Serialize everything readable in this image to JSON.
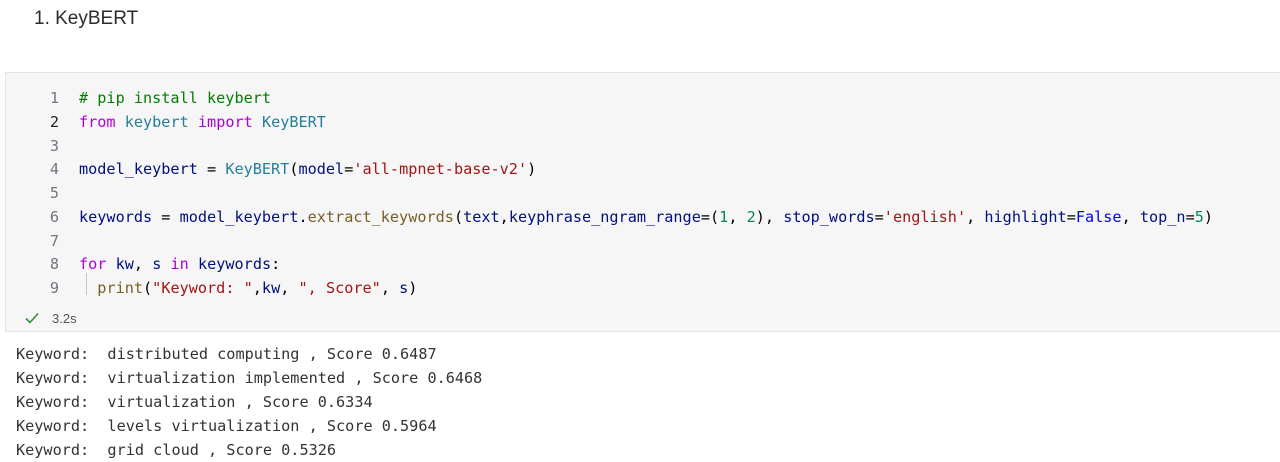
{
  "heading": "1. KeyBERT",
  "code": {
    "lines": [
      {
        "num": "1",
        "tokens": [
          {
            "t": "comment",
            "v": "# pip install keybert"
          }
        ]
      },
      {
        "num": "2",
        "tokens": [
          {
            "t": "kw",
            "v": "from"
          },
          {
            "t": "plain",
            "v": " "
          },
          {
            "t": "module",
            "v": "keybert"
          },
          {
            "t": "plain",
            "v": " "
          },
          {
            "t": "kw",
            "v": "import"
          },
          {
            "t": "plain",
            "v": " "
          },
          {
            "t": "module",
            "v": "KeyBERT"
          }
        ]
      },
      {
        "num": "3",
        "tokens": []
      },
      {
        "num": "4",
        "tokens": [
          {
            "t": "var",
            "v": "model_keybert"
          },
          {
            "t": "plain",
            "v": " = "
          },
          {
            "t": "module",
            "v": "KeyBERT"
          },
          {
            "t": "plain",
            "v": "("
          },
          {
            "t": "var",
            "v": "model"
          },
          {
            "t": "plain",
            "v": "="
          },
          {
            "t": "str",
            "v": "'all-mpnet-base-v2'"
          },
          {
            "t": "plain",
            "v": ")"
          }
        ]
      },
      {
        "num": "5",
        "tokens": []
      },
      {
        "num": "6",
        "tokens": [
          {
            "t": "var",
            "v": "keywords"
          },
          {
            "t": "plain",
            "v": " = "
          },
          {
            "t": "var",
            "v": "model_keybert"
          },
          {
            "t": "plain",
            "v": "."
          },
          {
            "t": "func",
            "v": "extract_keywords"
          },
          {
            "t": "plain",
            "v": "("
          },
          {
            "t": "var",
            "v": "text"
          },
          {
            "t": "plain",
            "v": ","
          },
          {
            "t": "var",
            "v": "keyphrase_ngram_range"
          },
          {
            "t": "plain",
            "v": "=("
          },
          {
            "t": "num",
            "v": "1"
          },
          {
            "t": "plain",
            "v": ", "
          },
          {
            "t": "num",
            "v": "2"
          },
          {
            "t": "plain",
            "v": "), "
          },
          {
            "t": "var",
            "v": "stop_words"
          },
          {
            "t": "plain",
            "v": "="
          },
          {
            "t": "str",
            "v": "'english'"
          },
          {
            "t": "plain",
            "v": ", "
          },
          {
            "t": "var",
            "v": "highlight"
          },
          {
            "t": "plain",
            "v": "="
          },
          {
            "t": "bool",
            "v": "False"
          },
          {
            "t": "plain",
            "v": ", "
          },
          {
            "t": "var",
            "v": "top_n"
          },
          {
            "t": "plain",
            "v": "="
          },
          {
            "t": "num",
            "v": "5"
          },
          {
            "t": "plain",
            "v": ")"
          }
        ]
      },
      {
        "num": "7",
        "tokens": []
      },
      {
        "num": "8",
        "tokens": [
          {
            "t": "kw",
            "v": "for"
          },
          {
            "t": "plain",
            "v": " "
          },
          {
            "t": "var",
            "v": "kw"
          },
          {
            "t": "plain",
            "v": ", "
          },
          {
            "t": "var",
            "v": "s"
          },
          {
            "t": "plain",
            "v": " "
          },
          {
            "t": "kw",
            "v": "in"
          },
          {
            "t": "plain",
            "v": " "
          },
          {
            "t": "var",
            "v": "keywords"
          },
          {
            "t": "plain",
            "v": ":"
          }
        ]
      },
      {
        "num": "9",
        "tokens": [
          {
            "t": "plain",
            "v": "  "
          },
          {
            "t": "func",
            "v": "print"
          },
          {
            "t": "plain",
            "v": "("
          },
          {
            "t": "str",
            "v": "\"Keyword: \""
          },
          {
            "t": "plain",
            "v": ","
          },
          {
            "t": "var",
            "v": "kw"
          },
          {
            "t": "plain",
            "v": ", "
          },
          {
            "t": "str",
            "v": "\", Score\""
          },
          {
            "t": "plain",
            "v": ", "
          },
          {
            "t": "var",
            "v": "s"
          },
          {
            "t": "plain",
            "v": ")"
          }
        ]
      }
    ],
    "active_line": "2"
  },
  "execution": {
    "status_icon": "check-icon",
    "time": "3.2s",
    "success_color": "#388a34"
  },
  "output": [
    "Keyword:  distributed computing , Score 0.6487",
    "Keyword:  virtualization implemented , Score 0.6468",
    "Keyword:  virtualization , Score 0.6334",
    "Keyword:  levels virtualization , Score 0.5964",
    "Keyword:  grid cloud , Score 0.5326"
  ]
}
